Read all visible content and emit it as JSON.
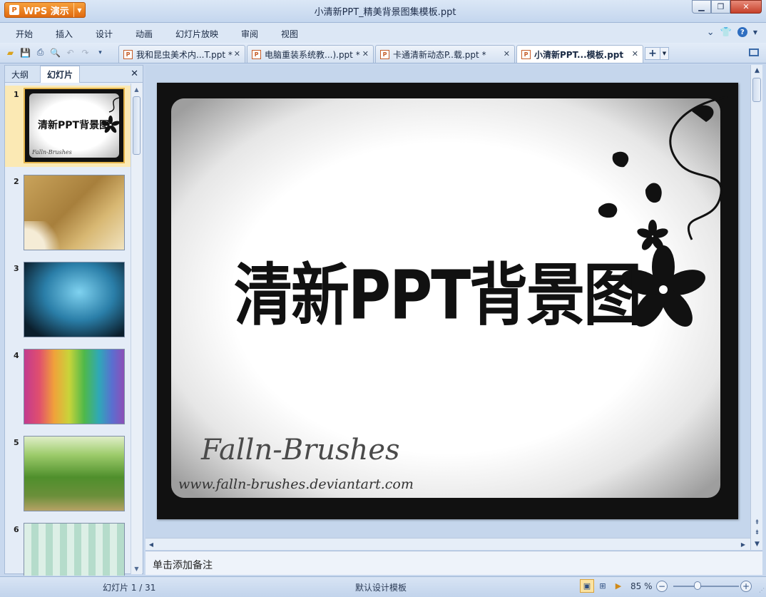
{
  "app": {
    "name": "WPS 演示",
    "window_title": "小清新PPT_精美背景图集模板.ppt"
  },
  "menu": {
    "items": [
      "开始",
      "插入",
      "设计",
      "动画",
      "幻灯片放映",
      "审阅",
      "视图"
    ]
  },
  "doc_tabs": [
    {
      "label": "我和昆虫美术内...T.ppt *",
      "active": false
    },
    {
      "label": "电脑重装系统教...).ppt *",
      "active": false
    },
    {
      "label": "卡通清新动态P..载.ppt *",
      "active": false
    },
    {
      "label": "小清新PPT...模板.ppt",
      "active": true
    }
  ],
  "left_pane": {
    "tabs": [
      "大纲",
      "幻灯片"
    ],
    "active_tab": "幻灯片",
    "thumbnails": [
      {
        "number": "1",
        "selected": true
      },
      {
        "number": "2",
        "selected": false
      },
      {
        "number": "3",
        "selected": false
      },
      {
        "number": "4",
        "selected": false
      },
      {
        "number": "5",
        "selected": false
      },
      {
        "number": "6",
        "selected": false
      }
    ]
  },
  "slide": {
    "title": "清新PPT背景图",
    "watermark_name": "Falln-Brushes",
    "watermark_url": "www.falln-brushes.deviantart.com"
  },
  "thumb1": {
    "title": "清新PPT背景图",
    "watermark": "Falln-Brushes"
  },
  "notes": {
    "placeholder": "单击添加备注"
  },
  "status": {
    "slide_position": "幻灯片 1 / 31",
    "template": "默认设计模板",
    "zoom": "85 %"
  },
  "colors": {
    "app_button": "#e06a10",
    "accent": "#2f6ec0",
    "selection": "#fbe9b4"
  }
}
